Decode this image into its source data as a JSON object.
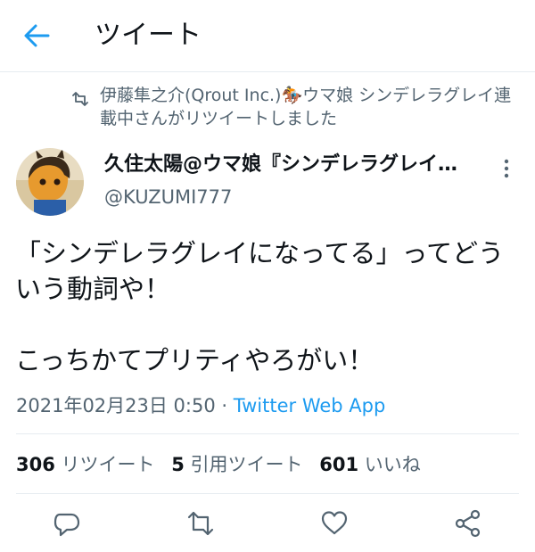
{
  "header": {
    "title": "ツイート"
  },
  "retweet_banner": {
    "text": "伊藤隼之介(Qrout Inc.)🏇ウマ娘 シンデレラグレイ連載中さんがリツイートしました"
  },
  "author": {
    "name": "久住太陽@ウマ娘『シンデレラグレイ…",
    "handle": "@KUZUMI777"
  },
  "tweet": {
    "text": "「シンデレラグレイになってる」ってどういう動詞や！\n\nこっちかてプリティやろがい！"
  },
  "meta": {
    "timestamp": "2021年02月23日 0:50",
    "separator": " · ",
    "source": "Twitter Web App"
  },
  "stats": {
    "retweets": {
      "count": "306",
      "label": "リツイート"
    },
    "quotes": {
      "count": "5",
      "label": "引用ツイート"
    },
    "likes": {
      "count": "601",
      "label": "いいね"
    }
  },
  "colors": {
    "accent": "#1d9bf0",
    "secondary_text": "#536471",
    "divider": "#e6ecf0"
  },
  "icons": [
    "back-arrow-icon",
    "retweet-icon",
    "more-vertical-icon",
    "reply-icon",
    "retweet-action-icon",
    "like-heart-icon",
    "share-icon"
  ]
}
